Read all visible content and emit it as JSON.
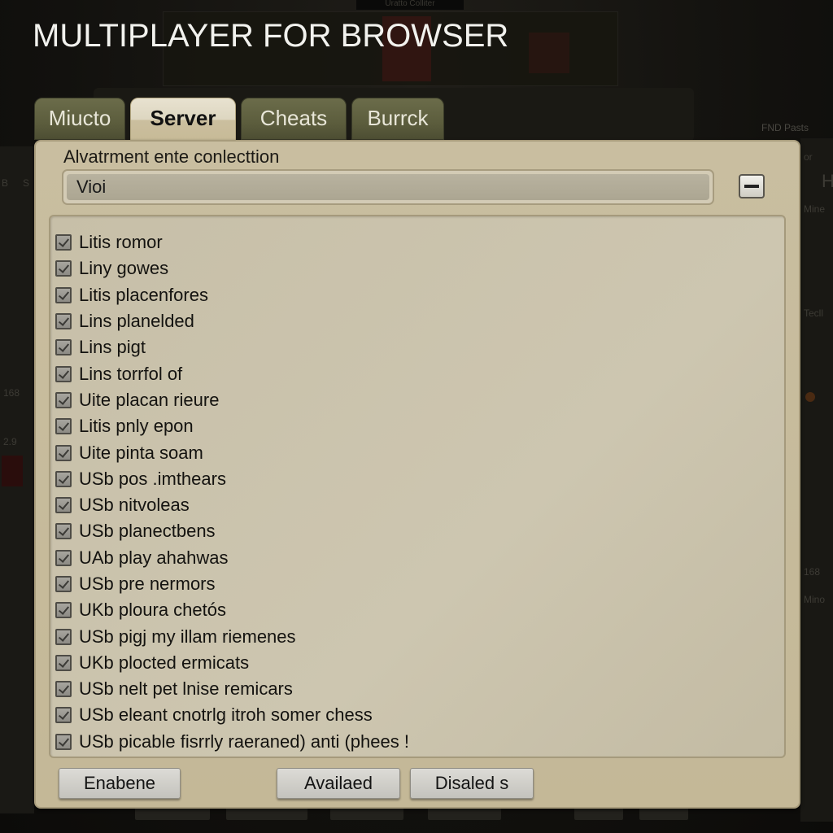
{
  "title": "MULTIPLAYER FOR BROWSER",
  "background": {
    "top_label": "Uratto Colliter",
    "right_label": "FND Pasts",
    "side_labels": [
      "B",
      "S",
      "168",
      "2.9",
      "or",
      "H",
      "Mine",
      "Tecll",
      "168",
      "Mino"
    ]
  },
  "tabs": [
    {
      "label": "Miucto",
      "active": false
    },
    {
      "label": "Server",
      "active": true
    },
    {
      "label": "Cheats",
      "active": false
    },
    {
      "label": "Burrck",
      "active": false
    }
  ],
  "panel": {
    "section_label": "Alvatrment ente conlecttion",
    "select_value": "Vioi",
    "collapse_icon": "minus-icon",
    "items": [
      {
        "label": "Litis romor",
        "checked": true
      },
      {
        "label": "Liny gowes",
        "checked": true
      },
      {
        "label": "Litis placenfores",
        "checked": true
      },
      {
        "label": "Lins planelded",
        "checked": true
      },
      {
        "label": "Lins pigt",
        "checked": true
      },
      {
        "label": "Lins torrfol of",
        "checked": true
      },
      {
        "label": "Uite placan rieure",
        "checked": true
      },
      {
        "label": "Litis pnly epon",
        "checked": true
      },
      {
        "label": "Uite pinta soam",
        "checked": true
      },
      {
        "label": "USb pos .imthears",
        "checked": true
      },
      {
        "label": "USb nitvoleas",
        "checked": true
      },
      {
        "label": "USb planectbens",
        "checked": true
      },
      {
        "label": "UAb play ahahwas",
        "checked": true
      },
      {
        "label": "USb pre nermors",
        "checked": true
      },
      {
        "label": "UKb ploura chetós",
        "checked": true
      },
      {
        "label": "USb pigj my illam riemenes",
        "checked": true
      },
      {
        "label": "UKb plocted ermicats",
        "checked": true
      },
      {
        "label": "USb nelt pet lnise remicars",
        "checked": true
      },
      {
        "label": "USb eleant cnotrlg itroh somer chess",
        "checked": true
      },
      {
        "label": "USb picable fisrrly raeraned) anti (phees !",
        "checked": true
      }
    ]
  },
  "buttons": {
    "enable": "Enabene",
    "available": "Availaed",
    "disabled": "Disaled s"
  }
}
